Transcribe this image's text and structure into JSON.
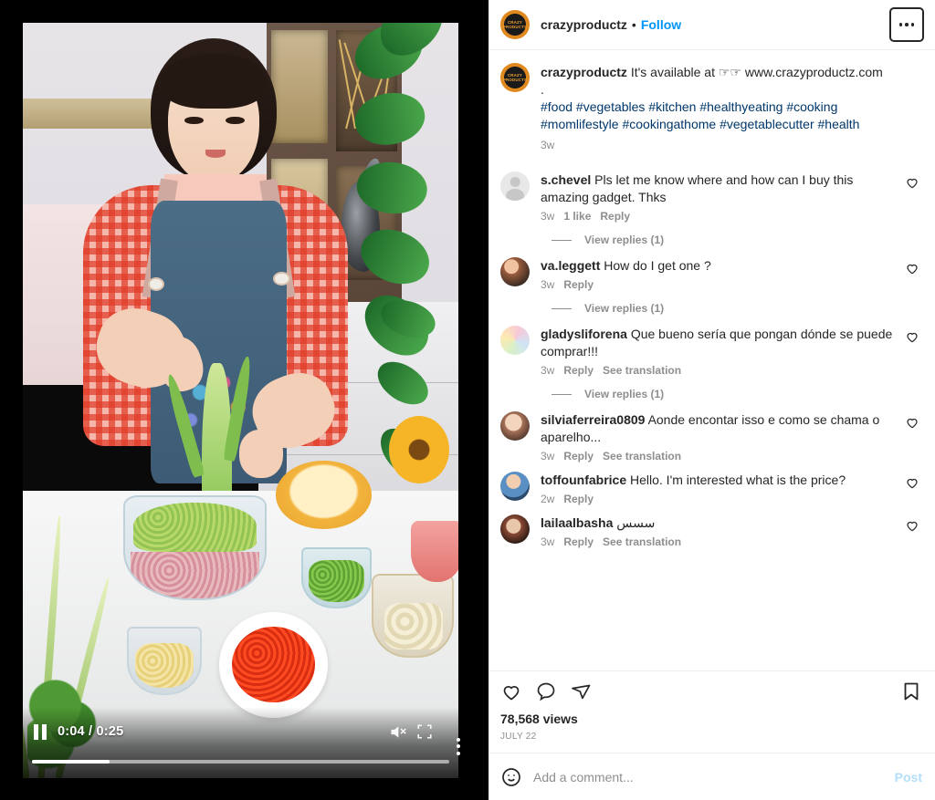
{
  "video": {
    "current_time": "0:04",
    "duration": "0:25",
    "time_display": "0:04 / 0:25",
    "progress_percent": 18.5,
    "is_paused": true,
    "is_muted": true,
    "controls": {
      "pause_label": "Pause",
      "mute_label": "Unmute",
      "fullscreen_label": "Full screen",
      "more_options_label": "More options"
    }
  },
  "header": {
    "username": "crazyproductz",
    "separator": "•",
    "follow_label": "Follow",
    "more_label": "More options",
    "avatar_line1": "CRAZY",
    "avatar_line2": "PRODUCTS"
  },
  "caption": {
    "username": "crazyproductz",
    "text": "It's available at ☞☞ www.crazyproductz.com",
    "second_line": ".",
    "hashtags_line1": "#food #vegetables #kitchen #healthyeating #cooking",
    "hashtags_line2": "#momlifestyle #cookingathome #vegetablecutter #health",
    "time": "3w"
  },
  "comments": [
    {
      "username": "s.chevel",
      "text": "Pls let me know where and how can I buy this amazing gadget. Thks",
      "time": "3w",
      "likes": "1 like",
      "reply_label": "Reply",
      "translation_label": "",
      "avatar_class": "ph",
      "replies_label": "View replies (1)"
    },
    {
      "username": "va.leggett",
      "text": "How do I get one ?",
      "time": "3w",
      "likes": "",
      "reply_label": "Reply",
      "translation_label": "",
      "avatar_class": "av-a",
      "replies_label": "View replies (1)"
    },
    {
      "username": "gladysliforena",
      "text": "Que bueno sería que pongan dónde se puede comprar!!!",
      "time": "3w",
      "likes": "",
      "reply_label": "Reply",
      "translation_label": "See translation",
      "avatar_class": "av-b",
      "replies_label": "View replies (1)"
    },
    {
      "username": "silviaferreira0809",
      "text": "Aonde encontar isso e como se chama o aparelho...",
      "time": "3w",
      "likes": "",
      "reply_label": "Reply",
      "translation_label": "See translation",
      "avatar_class": "av-c",
      "replies_label": ""
    },
    {
      "username": "toffounfabrice",
      "text": "Hello. I'm interested what is the price?",
      "time": "2w",
      "likes": "",
      "reply_label": "Reply",
      "translation_label": "",
      "avatar_class": "av-d",
      "replies_label": ""
    },
    {
      "username": "lailaalbasha",
      "text": "سسس",
      "time": "3w",
      "likes": "",
      "reply_label": "Reply",
      "translation_label": "See translation",
      "avatar_class": "av-e",
      "replies_label": ""
    }
  ],
  "actions": {
    "like_label": "Like",
    "comment_label": "Comment",
    "share_label": "Share",
    "save_label": "Save",
    "views": "78,568 views",
    "date": "JULY 22"
  },
  "add_comment": {
    "placeholder": "Add a comment...",
    "value": "",
    "post_label": "Post",
    "emoji_label": "Emoji picker"
  },
  "colors": {
    "link_blue": "#0095f6",
    "tag_blue": "#00376b",
    "text_primary": "#262626",
    "text_secondary": "#8e8e8e",
    "post_disabled": "#b2dffc",
    "brand_orange": "#e0891f"
  }
}
